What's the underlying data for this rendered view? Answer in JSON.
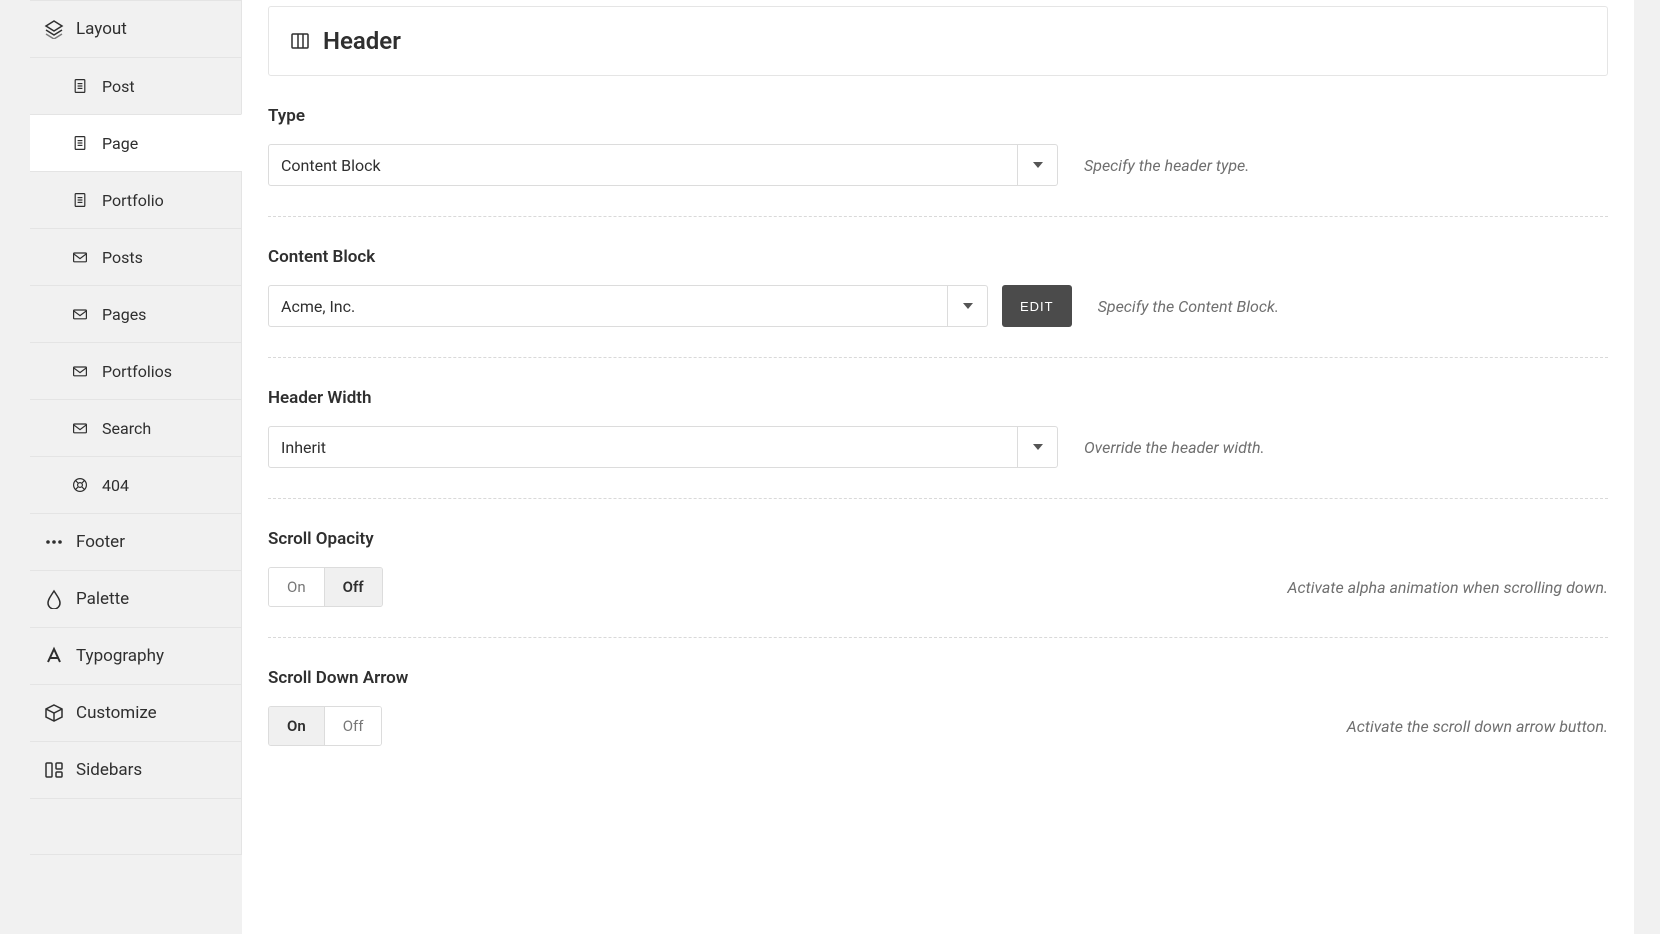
{
  "sidebar": {
    "items": [
      {
        "label": "Layout",
        "icon": "layers-icon",
        "level": "top"
      },
      {
        "label": "Post",
        "icon": "file-icon",
        "level": "sub"
      },
      {
        "label": "Page",
        "icon": "file-icon",
        "level": "sub",
        "active": true
      },
      {
        "label": "Portfolio",
        "icon": "file-icon",
        "level": "sub"
      },
      {
        "label": "Posts",
        "icon": "archive-icon",
        "level": "sub"
      },
      {
        "label": "Pages",
        "icon": "archive-icon",
        "level": "sub"
      },
      {
        "label": "Portfolios",
        "icon": "archive-icon",
        "level": "sub"
      },
      {
        "label": "Search",
        "icon": "archive-icon",
        "level": "sub"
      },
      {
        "label": "404",
        "icon": "lifebuoy-icon",
        "level": "sub"
      },
      {
        "label": "Footer",
        "icon": "dots-icon",
        "level": "top"
      },
      {
        "label": "Palette",
        "icon": "drop-icon",
        "level": "top"
      },
      {
        "label": "Typography",
        "icon": "font-icon",
        "level": "top"
      },
      {
        "label": "Customize",
        "icon": "cube-icon",
        "level": "top"
      },
      {
        "label": "Sidebars",
        "icon": "sidebars-icon",
        "level": "top"
      }
    ]
  },
  "panel": {
    "title": "Header",
    "fields": {
      "type": {
        "label": "Type",
        "value": "Content Block",
        "hint": "Specify the header type."
      },
      "content_block": {
        "label": "Content Block",
        "value": "Acme, Inc.",
        "edit_label": "EDIT",
        "hint": "Specify the Content Block."
      },
      "header_width": {
        "label": "Header Width",
        "value": "Inherit",
        "hint": "Override the header width."
      },
      "scroll_opacity": {
        "label": "Scroll Opacity",
        "on_label": "On",
        "off_label": "Off",
        "value": "Off",
        "hint": "Activate alpha animation when scrolling down."
      },
      "scroll_down_arrow": {
        "label": "Scroll Down Arrow",
        "on_label": "On",
        "off_label": "Off",
        "value": "On",
        "hint": "Activate the scroll down arrow button."
      }
    }
  }
}
